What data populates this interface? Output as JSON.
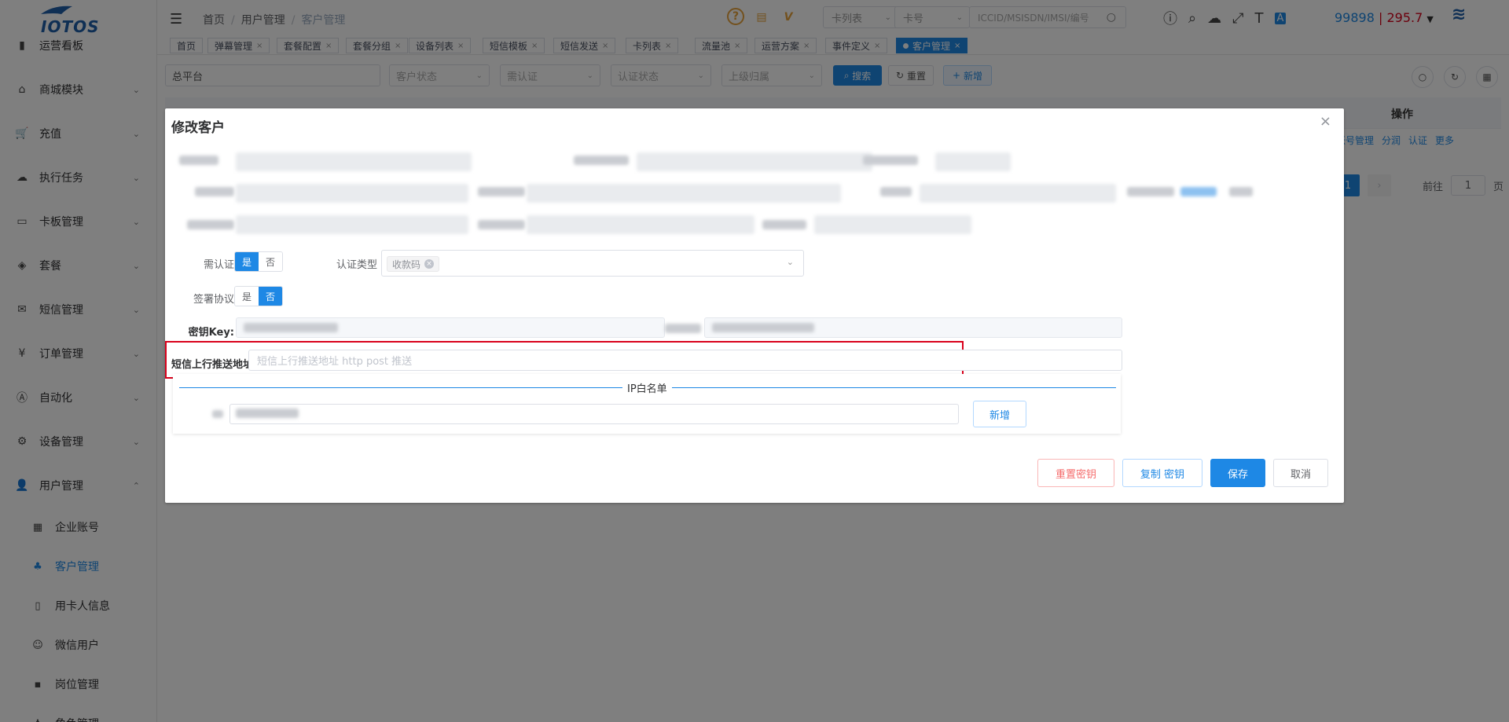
{
  "app": {
    "logo_text": "IOTOS"
  },
  "sidebar": {
    "items": [
      {
        "label": "运营看板",
        "icon": "bar-chart-icon",
        "glyph": "▮"
      },
      {
        "label": "商城模块",
        "icon": "shop-icon",
        "glyph": "⌂"
      },
      {
        "label": "充值",
        "icon": "cart-icon",
        "glyph": "🛒"
      },
      {
        "label": "执行任务",
        "icon": "cloud-icon",
        "glyph": "☁"
      },
      {
        "label": "卡板管理",
        "icon": "card-icon",
        "glyph": "▭"
      },
      {
        "label": "套餐",
        "icon": "layers-icon",
        "glyph": "◈"
      },
      {
        "label": "短信管理",
        "icon": "mail-icon",
        "glyph": "✉"
      },
      {
        "label": "订单管理",
        "icon": "yen-icon",
        "glyph": "¥"
      },
      {
        "label": "自动化",
        "icon": "auto-icon",
        "glyph": "Ⓐ"
      },
      {
        "label": "设备管理",
        "icon": "device-icon",
        "glyph": "⚙"
      },
      {
        "label": "用户管理",
        "icon": "user-icon",
        "glyph": "👤"
      }
    ],
    "subitems": [
      {
        "label": "企业账号",
        "icon": "building-icon",
        "glyph": "▦"
      },
      {
        "label": "客户管理",
        "icon": "org-icon",
        "glyph": "♣"
      },
      {
        "label": "用卡人信息",
        "icon": "phone-icon",
        "glyph": "▯"
      },
      {
        "label": "微信用户",
        "icon": "wechat-icon",
        "glyph": "☺"
      },
      {
        "label": "岗位管理",
        "icon": "post-icon",
        "glyph": "▪"
      },
      {
        "label": "角色管理",
        "icon": "role-icon",
        "glyph": "♟"
      }
    ]
  },
  "header": {
    "breadcrumb": [
      "首页",
      "用户管理",
      "客户管理"
    ],
    "card_list_select": "卡列表",
    "card_no_select": "卡号",
    "search_placeholder": "ICCID/MSISDN/IMSI/编号",
    "balance_a": "99898",
    "balance_sep": "|",
    "balance_b": "295.7"
  },
  "tabs": [
    "首页",
    "弹幕管理",
    "套餐配置",
    "套餐分组",
    "设备列表",
    "短信模板",
    "短信发送",
    "卡列表",
    "流量池",
    "运营方案",
    "事件定义",
    "客户管理"
  ],
  "filters": {
    "platform": "总平台",
    "customer_status": "客户状态",
    "need_auth": "需认证",
    "auth_status": "认证状态",
    "parent": "上级归属",
    "search_btn": "搜索",
    "reset_btn": "重置",
    "add_btn": "新增"
  },
  "table": {
    "op_header": "操作",
    "row_actions": [
      "账号管理",
      "分润",
      "认证",
      "更多"
    ]
  },
  "pager": {
    "current": "1",
    "goto_label": "前往",
    "goto_value": "1",
    "page_unit": "页"
  },
  "dialog": {
    "title": "修改客户",
    "need_auth_label": "需认证",
    "yes": "是",
    "no": "否",
    "need_auth_value": "是",
    "auth_type_label": "认证类型",
    "auth_type_tag": "收款码",
    "sign_label": "签署协议",
    "sign_value": "否",
    "secret_key_label": "密钥Key:",
    "sms_push_label": "短信上行推送地址",
    "sms_push_placeholder": "短信上行推送地址 http post 推送",
    "ip_whitelist_title": "IP白名单",
    "ip_add_btn": "新增",
    "reset_key_btn": "重置密钥",
    "copy_key_btn": "复制 密钥",
    "save_btn": "保存",
    "cancel_btn": "取消"
  },
  "colors": {
    "primary": "#1e88e5",
    "danger": "#d9001b"
  }
}
